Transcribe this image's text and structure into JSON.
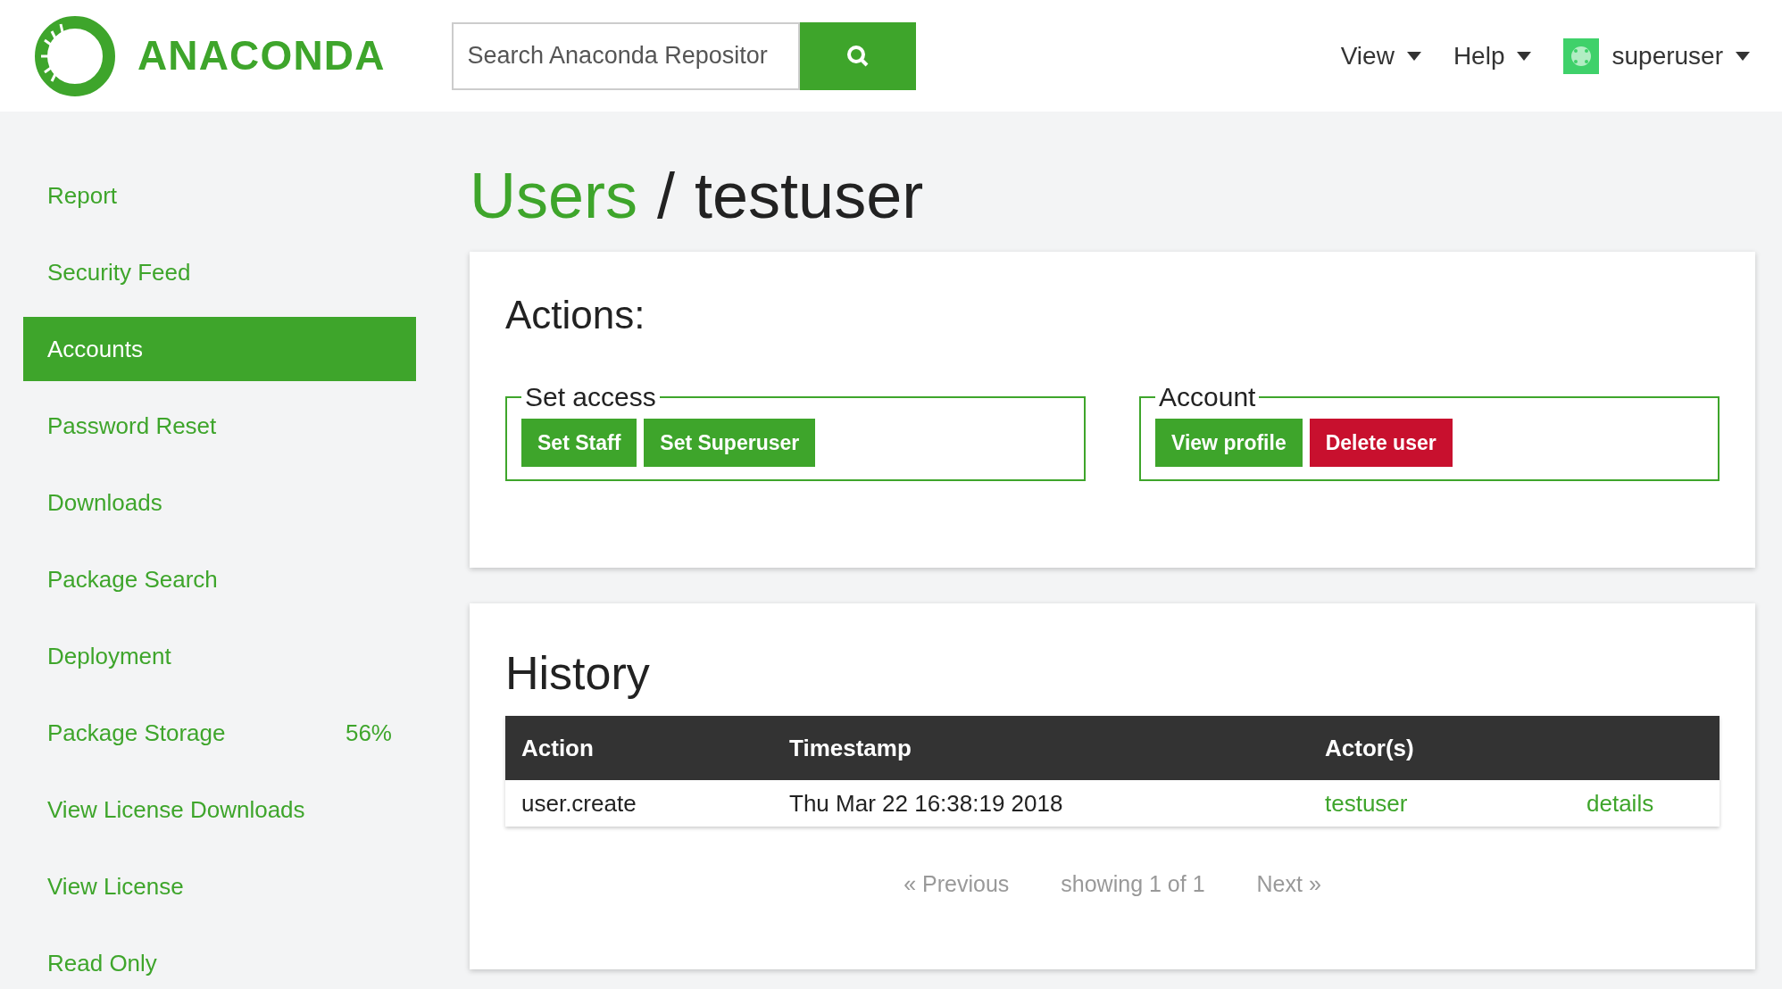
{
  "header": {
    "logo_text": "ANACONDA",
    "search": {
      "placeholder": "Search Anaconda Repositor"
    },
    "menus": [
      {
        "label": "View",
        "kind": "menu"
      },
      {
        "label": "Help",
        "kind": "menu"
      },
      {
        "label": "superuser",
        "kind": "user"
      }
    ]
  },
  "sidebar": {
    "items": [
      {
        "label": "Report",
        "selected": false
      },
      {
        "label": "Security Feed",
        "selected": false
      },
      {
        "label": "Accounts",
        "selected": true
      },
      {
        "label": "Password Reset",
        "selected": false
      },
      {
        "label": "Downloads",
        "selected": false
      },
      {
        "label": "Package Search",
        "selected": false
      },
      {
        "label": "Deployment",
        "selected": false
      },
      {
        "label": "Package Storage",
        "selected": false,
        "value": "56%"
      },
      {
        "label": "View License Downloads",
        "selected": false
      },
      {
        "label": "View License",
        "selected": false
      },
      {
        "label": "Read Only",
        "selected": false
      }
    ]
  },
  "breadcrumb": {
    "parent": "Users",
    "separator": "/",
    "current": "testuser"
  },
  "actions": {
    "title": "Actions:",
    "groups": [
      {
        "legend": "Set access",
        "buttons": [
          {
            "label": "Set Staff",
            "kind": "primary"
          },
          {
            "label": "Set Superuser",
            "kind": "primary"
          }
        ]
      },
      {
        "legend": "Account",
        "buttons": [
          {
            "label": "View profile",
            "kind": "primary"
          },
          {
            "label": "Delete user",
            "kind": "danger"
          }
        ]
      }
    ]
  },
  "history": {
    "title": "History",
    "table": {
      "columns": [
        "Action",
        "Timestamp",
        "Actor(s)",
        ""
      ],
      "rows": [
        {
          "action": "user.create",
          "timestamp": "Thu Mar 22 16:38:19 2018",
          "actor": "testuser",
          "link": "details"
        }
      ]
    },
    "pagination": {
      "previous": "« Previous",
      "status": "showing 1 of 1",
      "next": "Next »"
    }
  }
}
